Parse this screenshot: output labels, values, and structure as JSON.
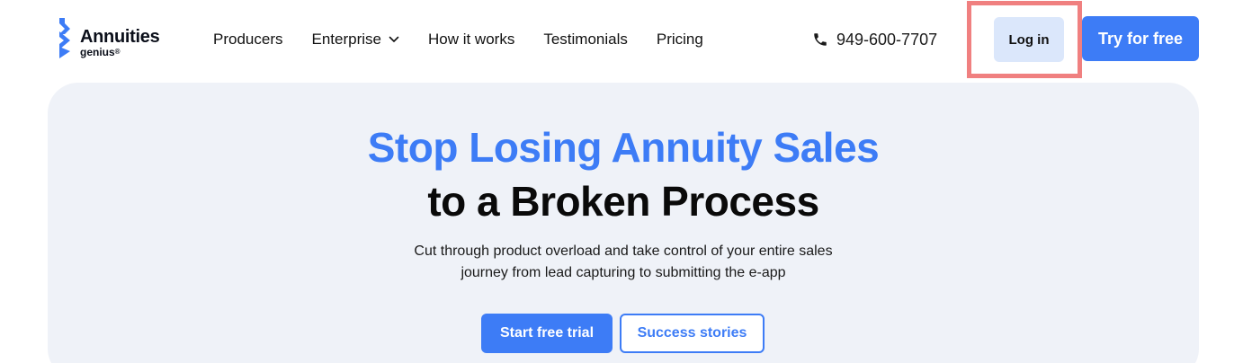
{
  "brand": {
    "name": "Annuities",
    "sub": "genius",
    "reg": "®",
    "logo_color": "#3d7cf6"
  },
  "nav": {
    "items": [
      {
        "label": "Producers",
        "has_dropdown": false
      },
      {
        "label": "Enterprise",
        "has_dropdown": true
      },
      {
        "label": "How it works",
        "has_dropdown": false
      },
      {
        "label": "Testimonials",
        "has_dropdown": false
      },
      {
        "label": "Pricing",
        "has_dropdown": false
      }
    ],
    "dropdown_icon": "chevron-down-icon"
  },
  "contact": {
    "phone": "949-600-7707",
    "icon": "phone-icon"
  },
  "actions": {
    "login_label": "Log in",
    "try_label": "Try for free"
  },
  "hero": {
    "title_line1": "Stop Losing Annuity Sales",
    "title_line2": "to a Broken Process",
    "subtitle_line1": "Cut through product overload and take control of your entire sales",
    "subtitle_line2": "journey from lead capturing to submitting the e-app",
    "primary_cta": "Start free trial",
    "secondary_cta": "Success stories"
  },
  "colors": {
    "accent": "#3d7cf6",
    "hero_bg": "#eff2f8",
    "login_bg": "#dbe7fb",
    "highlight": "#f08080"
  }
}
